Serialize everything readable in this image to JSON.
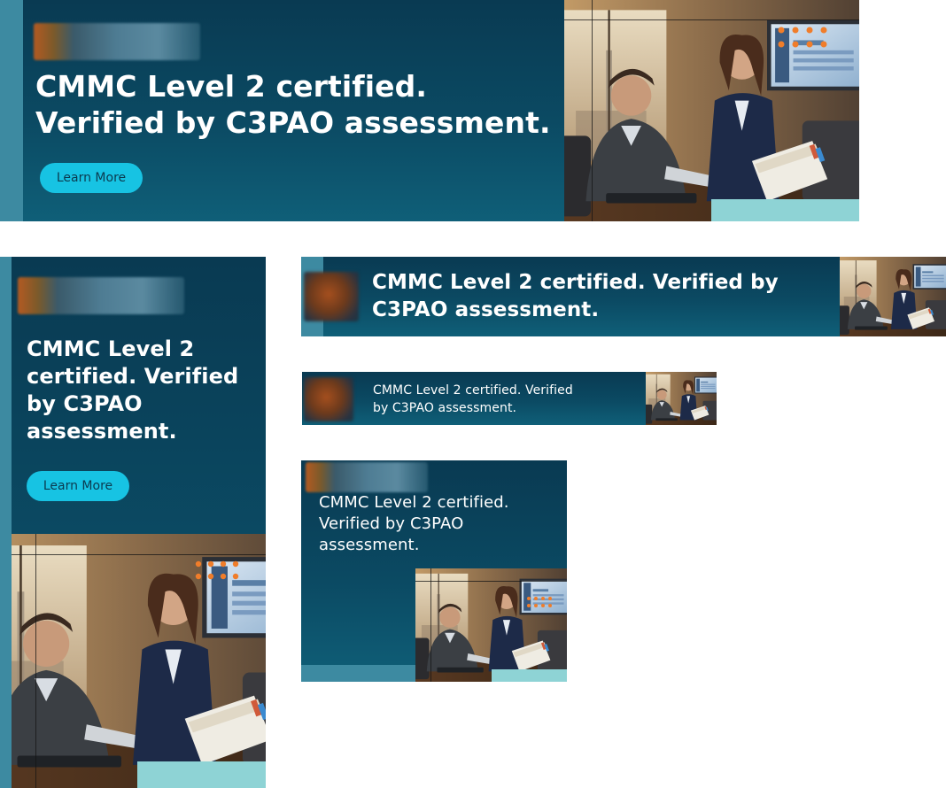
{
  "ads": {
    "headline": "CMMC Level 2 certified. Verified by C3PAO assessment.",
    "cta_label": "Learn More",
    "wide": {
      "headline_line1": "CMMC Level 2 certified.",
      "headline_line2": "Verified by C3PAO assessment."
    },
    "tall": {
      "headline_line1": "CMMC Level 2",
      "headline_line2": "certified. Verified",
      "headline_line3": "by C3PAO",
      "headline_line4": "assessment."
    },
    "leaderboard": {
      "headline_line1": "CMMC Level 2 certified. Verified by",
      "headline_line2": "C3PAO assessment."
    },
    "mobile": {
      "headline_line1": "CMMC Level 2 certified. Verified",
      "headline_line2": "by C3PAO assessment."
    },
    "medium": {
      "headline_line1": "CMMC Level 2 certified.",
      "headline_line2": "Verified by C3PAO",
      "headline_line3": "assessment."
    }
  },
  "colors": {
    "ad_background": "#0b4a63",
    "cta_background": "#17c3e3",
    "accent_stripe": "#3d8aa1",
    "accent_teal": "#8ed3d5",
    "dot_accent": "#f07d2a"
  }
}
